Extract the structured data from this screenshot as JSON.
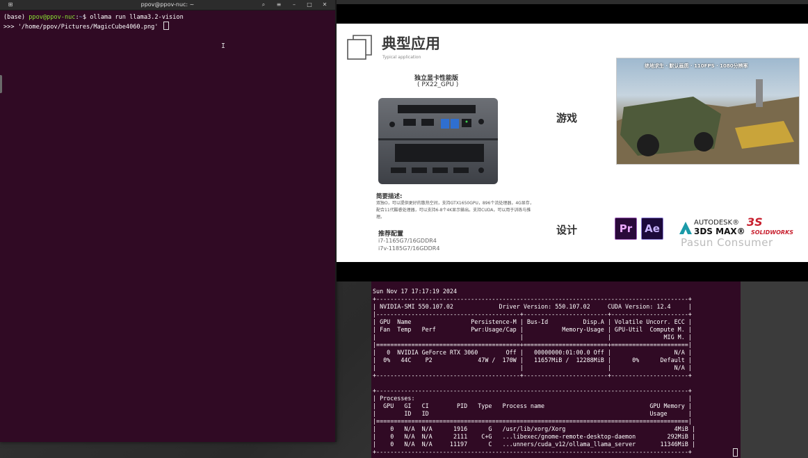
{
  "terminal_left": {
    "title": "ppov@ppov-nuc: ~",
    "newtab_icon": "new-tab-icon",
    "buttons": [
      "search-icon",
      "menu-icon",
      "minimize-icon",
      "maximize-icon",
      "close-icon"
    ],
    "prompt_prefix": "(base) ",
    "prompt_user": "ppov@ppov-nuc",
    "prompt_sep": ":",
    "prompt_path": "~",
    "prompt_dollar": "$ ",
    "command": "ollama run llama3.2-vision",
    "input_line": ">>> '/home/ppov/Pictures/MagicCube4060.png' ",
    "ibeam": "I"
  },
  "slide": {
    "title": "典型应用",
    "subtitle": "Typical application",
    "gpu_label": "独立显卡性能版",
    "gpu_model": "( PX22_GPU )",
    "desc_head": "简要描述:",
    "desc_text": "双独O，可以提供更好的散热空间，支持GTX1650GPU，896个流处理器，4G显存，配合11代酷睿处理器，可以支持6-8个4K显示输出。支持CUDA，可以用于训练与推理。",
    "config_head": "推荐配置",
    "config_lines": [
      "i7-1165G7/16GDDR4",
      "i7v-1185G7/16GDDR4"
    ],
    "category_game": "游戏",
    "category_design": "设计",
    "game_caption": "绝地求生 · 默认画质 · 110FPS · 1080分辨率",
    "logos": {
      "pr": "Pr",
      "ae": "Ae",
      "autodesk": "AUTODESK®",
      "max": "3DS MAX®",
      "sw_mark": "3S",
      "sw_text": "SOLIDWORKS"
    },
    "watermark": "Pasun Consumer"
  },
  "nvidia_smi": {
    "lines": [
      "Sun Nov 17 17:17:19 2024",
      "+-----------------------------------------------------------------------------------------+",
      "| NVIDIA-SMI 550.107.02             Driver Version: 550.107.02     CUDA Version: 12.4     |",
      "|-----------------------------------------+------------------------+----------------------+",
      "| GPU  Name                 Persistence-M | Bus-Id          Disp.A | Volatile Uncorr. ECC |",
      "| Fan  Temp   Perf          Pwr:Usage/Cap |           Memory-Usage | GPU-Util  Compute M. |",
      "|                                         |                        |               MIG M. |",
      "|=========================================+========================+======================|",
      "|   0  NVIDIA GeForce RTX 3060        Off |   00000000:01:00.0 Off |                  N/A |",
      "|  0%   44C    P2             47W /  170W |   11657MiB /  12288MiB |      0%      Default |",
      "|                                         |                        |                  N/A |",
      "+-----------------------------------------+------------------------+----------------------+",
      "",
      "+-----------------------------------------------------------------------------------------+",
      "| Processes:                                                                              |",
      "|  GPU   GI   CI        PID   Type   Process name                              GPU Memory |",
      "|        ID   ID                                                               Usage      |",
      "|=========================================================================================|",
      "|    0   N/A  N/A      1916      G   /usr/lib/xorg/Xorg                               4MiB |",
      "|    0   N/A  N/A      2111    C+G   ...libexec/gnome-remote-desktop-daemon         292MiB |",
      "|    0   N/A  N/A     11197      C   ...unners/cuda_v12/ollama_llama_server       11346MiB |",
      "+-----------------------------------------------------------------------------------------+"
    ]
  }
}
